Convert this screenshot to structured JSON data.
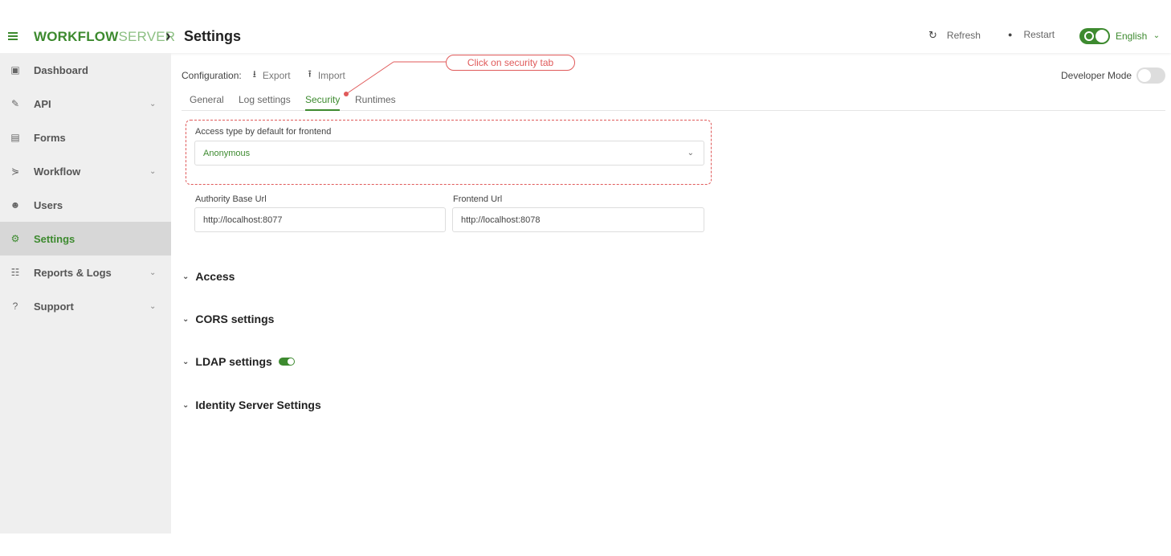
{
  "header": {
    "logo_bold": "WORKFLOW",
    "logo_light": "SERVER",
    "breadcrumb_sep": "›",
    "title": "Settings",
    "refresh_label": "Refresh",
    "restart_label": "Restart",
    "language": "English",
    "refresh_icon": "↻",
    "restart_icon": "●",
    "language_chevron": "⌄"
  },
  "sidebar": {
    "items": [
      {
        "label": "Dashboard",
        "icon": "dashboard-icon",
        "glyph": "▣",
        "expandable": false
      },
      {
        "label": "API",
        "icon": "plug-icon",
        "glyph": "✎",
        "expandable": true
      },
      {
        "label": "Forms",
        "icon": "form-icon",
        "glyph": "▤",
        "expandable": false
      },
      {
        "label": "Workflow",
        "icon": "workflow-icon",
        "glyph": "⋟",
        "expandable": true
      },
      {
        "label": "Users",
        "icon": "users-icon",
        "glyph": "☻",
        "expandable": false
      },
      {
        "label": "Settings",
        "icon": "gears-icon",
        "glyph": "⚙",
        "expandable": false,
        "active": true
      },
      {
        "label": "Reports & Logs",
        "icon": "reports-icon",
        "glyph": "☷",
        "expandable": true
      },
      {
        "label": "Support",
        "icon": "help-icon",
        "glyph": "?",
        "expandable": true
      }
    ],
    "chevron": "⌄"
  },
  "config": {
    "label": "Configuration:",
    "export_label": "Export",
    "import_label": "Import",
    "export_icon": "⭳",
    "import_icon": "⭱"
  },
  "developer_mode": {
    "label": "Developer Mode",
    "enabled": false
  },
  "tabs": [
    {
      "label": "General"
    },
    {
      "label": "Log settings"
    },
    {
      "label": "Security",
      "active": true
    },
    {
      "label": "Runtimes"
    }
  ],
  "annotation": {
    "text": "Click on security tab"
  },
  "security": {
    "access_type_label": "Access type by default for frontend",
    "access_type_value": "Anonymous",
    "authority_label": "Authority Base Url",
    "authority_value": "http://localhost:8077",
    "frontend_label": "Frontend Url",
    "frontend_value": "http://localhost:8078",
    "select_chevron": "⌄"
  },
  "sections": [
    {
      "label": "Access"
    },
    {
      "label": "CORS settings"
    },
    {
      "label": "LDAP settings",
      "toggle": true
    },
    {
      "label": "Identity Server Settings"
    }
  ],
  "section_chevron": "⌄",
  "colors": {
    "accent": "#3d8a2f",
    "annotation": "#e05a5a"
  }
}
